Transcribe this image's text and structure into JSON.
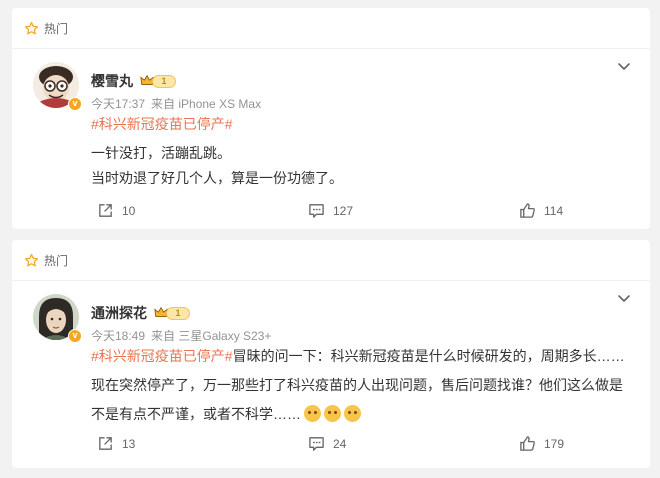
{
  "posts": [
    {
      "hot_label": "热门",
      "user_name": "樱雪丸",
      "level": "1",
      "time": "今天17:37",
      "source": "来自 iPhone XS Max",
      "topic": "#科兴新冠疫苗已停产#",
      "lines": [
        "一针没打，活蹦乱跳。",
        "当时劝退了好几个人，算是一份功德了。"
      ],
      "reposts": "10",
      "comments": "127",
      "likes": "114"
    },
    {
      "hot_label": "热门",
      "user_name": "通洲探花",
      "level": "1",
      "time": "今天18:49",
      "source": "来自 三星Galaxy S23+",
      "topic": "#科兴新冠疫苗已停产#",
      "line1_rest": "冒昧的问一下：科兴新冠疫苗是什么时候研发的，周期多长……",
      "line2": "现在突然停产了，万一那些打了科兴疫苗的人出现问题，售后问题找谁？他们这么做是",
      "line3": "不是有点不严谨，或者不科学……",
      "emoji_names": [
        "bear-face-emoji",
        "bear-face-emoji",
        "bear-face-emoji"
      ],
      "reposts": "13",
      "comments": "24",
      "likes": "179"
    }
  ],
  "colors": {
    "topic": "#eb7350",
    "meta": "#939393",
    "badge": "#f5a623",
    "background": "#f2f2f2"
  }
}
